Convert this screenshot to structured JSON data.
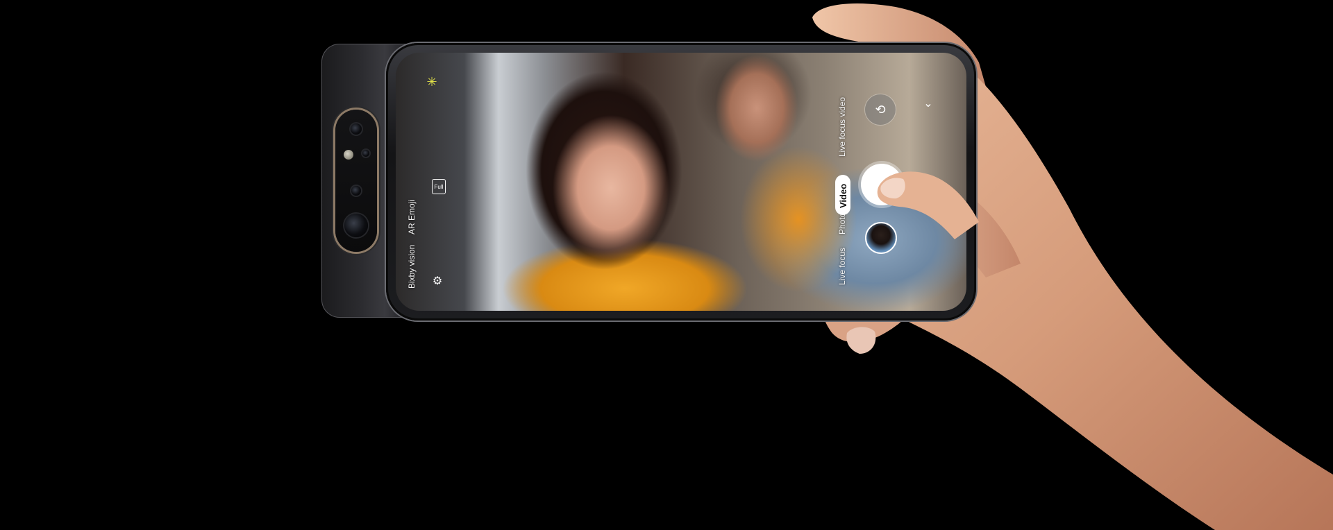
{
  "camera": {
    "modes": {
      "bixby_vision": "Bixby vision",
      "ar_emoji": "AR Emoji",
      "live_focus": "Live focus",
      "photo": "Photo",
      "video": "Video",
      "live_focus_video": "Live focus video"
    },
    "selected_mode": "Video",
    "icons": {
      "effects": "sparkle-icon",
      "aspect_ratio": "full-screen-ratio-icon",
      "settings": "gear-icon",
      "switch_camera": "switch-camera-icon",
      "expand": "chevron-down-icon",
      "aspect_ratio_label": "Full"
    }
  },
  "colors": {
    "background": "#000000",
    "accent_effect_icon": "#e6e64a",
    "selected_pill": "#ffffff"
  }
}
